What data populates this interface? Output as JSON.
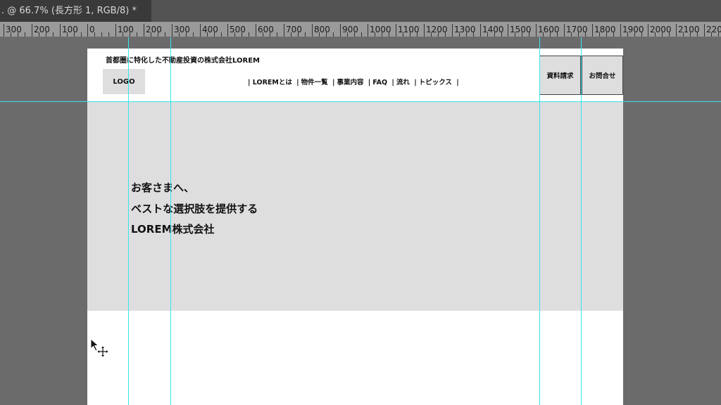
{
  "window": {
    "doc_tab_title": ". @ 66.7% (長方形 1, RGB/8) *"
  },
  "ruler": {
    "labels": [
      "300",
      "200",
      "100",
      "0",
      "100",
      "200",
      "300",
      "400",
      "500",
      "600",
      "700",
      "800",
      "900",
      "1000",
      "1100",
      "1200",
      "1300",
      "1400",
      "1500",
      "1600",
      "1700",
      "1800",
      "1900",
      "2000",
      "2100",
      "220"
    ]
  },
  "site": {
    "tagline": "首都圏に特化した不動産投資の株式会社LOREM",
    "logo": "LOGO",
    "nav": [
      "LOREMとは",
      "物件一覧",
      "事業内容",
      "FAQ",
      "流れ",
      "トピックス"
    ],
    "nav_separator": "|",
    "buttons": {
      "request_docs": "資料請求",
      "contact": "お問合せ"
    },
    "hero": {
      "line1": "お客さまへ、",
      "line2": "ベストな選択肢を提供する",
      "line3": "LOREM株式会社"
    }
  },
  "colors": {
    "guide": "#35e5f2",
    "pasteboard": "#6b6b6b",
    "placeholder_gray": "#dedede"
  }
}
